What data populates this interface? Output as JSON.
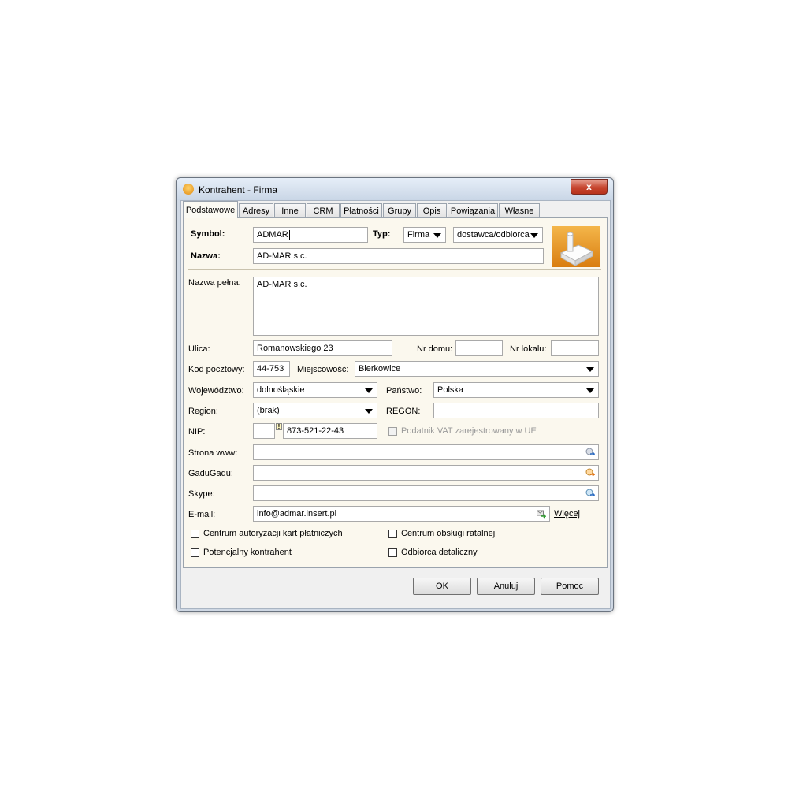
{
  "window": {
    "title": "Kontrahent - Firma",
    "close": "x"
  },
  "tabs": [
    "Podstawowe",
    "Adresy",
    "Inne",
    "CRM",
    "Płatności",
    "Grupy",
    "Opis",
    "Powiązania",
    "Własne"
  ],
  "form": {
    "symbol_label": "Symbol:",
    "symbol_value": "ADMAR",
    "typ_label": "Typ:",
    "typ_value": "Firma",
    "role_value": "dostawca/odbiorca",
    "nazwa_label": "Nazwa:",
    "nazwa_value": "AD-MAR s.c.",
    "nazwa_pelna_label": "Nazwa pełna:",
    "nazwa_pelna_value": "AD-MAR s.c.",
    "ulica_label": "Ulica:",
    "ulica_value": "Romanowskiego 23",
    "nr_domu_label": "Nr domu:",
    "nr_domu_value": "",
    "nr_lokalu_label": "Nr lokalu:",
    "nr_lokalu_value": "",
    "kod_label": "Kod pocztowy:",
    "kod_value": "44-753",
    "miejscowosc_label": "Miejscowość:",
    "miejscowosc_value": "Bierkowice",
    "wojewodztwo_label": "Województwo:",
    "wojewodztwo_value": "dolnośląskie",
    "panstwo_label": "Państwo:",
    "panstwo_value": "Polska",
    "region_label": "Region:",
    "region_value": "(brak)",
    "regon_label": "REGON:",
    "regon_value": "",
    "nip_label": "NIP:",
    "nip_prefix": "",
    "nip_warning": "!",
    "nip_value": "873-521-22-43",
    "vat_label": "Podatnik VAT zarejestrowany w UE",
    "www_label": "Strona www:",
    "www_value": "",
    "gg_label": "GaduGadu:",
    "gg_value": "",
    "skype_label": "Skype:",
    "skype_value": "",
    "email_label": "E-mail:",
    "email_value": "info@admar.insert.pl",
    "wiecej_label": "Więcej"
  },
  "checkboxes": {
    "c1": "Centrum autoryzacji kart płatniczych",
    "c2": "Centrum obsługi ratalnej",
    "c3": "Potencjalny kontrahent",
    "c4": "Odbiorca detaliczny"
  },
  "buttons": {
    "ok": "OK",
    "cancel": "Anuluj",
    "help": "Pomoc"
  },
  "colors": {
    "panel": "#fbf8ee",
    "accent": "#e08a12"
  }
}
